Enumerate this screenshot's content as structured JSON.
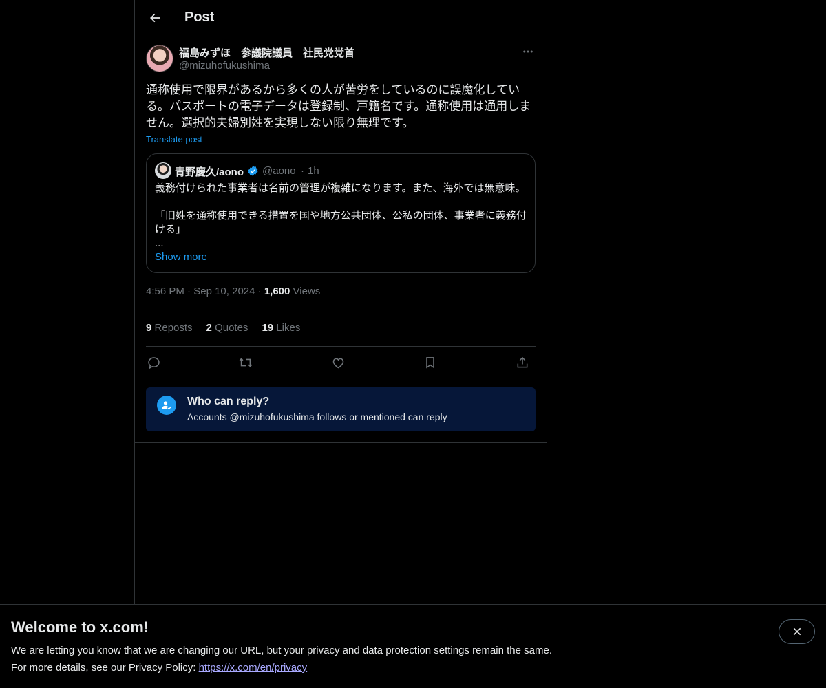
{
  "header": {
    "title": "Post",
    "back_icon": "arrow-left-icon"
  },
  "post": {
    "author_name": "福島みずほ　参議院議員　社民党党首",
    "author_handle": "@mizuhofukushima",
    "text": "通称使用で限界があるから多くの人が苦労をしているのに誤魔化している。パスポートの電子データは登録制、戸籍名です。通称使用は通用しません。選択的夫婦別姓を実現しない限り無理です。",
    "translate_label": "Translate post",
    "time": "4:56 PM",
    "date": "Sep 10, 2024",
    "views_count": "1,600",
    "views_label": "Views",
    "separator": "·"
  },
  "quote": {
    "author_name": "青野慶久/aono",
    "author_handle": "@aono",
    "time": "1h",
    "separator": "·",
    "line1": "義務付けられた事業者は名前の管理が複雑になります。また、海外では無意味。",
    "line2": "「旧姓を通称使用できる措置を国や地方公共団体、公私の団体、事業者に義務付ける」",
    "ellipsis": "...",
    "show_more": "Show more"
  },
  "stats": {
    "reposts_count": "9",
    "reposts_label": "Reposts",
    "quotes_count": "2",
    "quotes_label": "Quotes",
    "likes_count": "19",
    "likes_label": "Likes"
  },
  "actions": [
    "reply-icon",
    "repost-icon",
    "like-icon",
    "bookmark-icon",
    "share-icon"
  ],
  "who_can_reply": {
    "title": "Who can reply?",
    "subtitle": "Accounts @mizuhofukushima follows or mentioned can reply"
  },
  "banner": {
    "title": "Welcome to x.com!",
    "line1": "We are letting you know that we are changing our URL, but your privacy and data protection settings remain the same.",
    "line2_prefix": "For more details, see our Privacy Policy: ",
    "link": "https://x.com/en/privacy"
  },
  "colors": {
    "accent": "#1d9bf0",
    "background": "#000000",
    "muted": "#71767b",
    "reply_box": "#061739"
  }
}
